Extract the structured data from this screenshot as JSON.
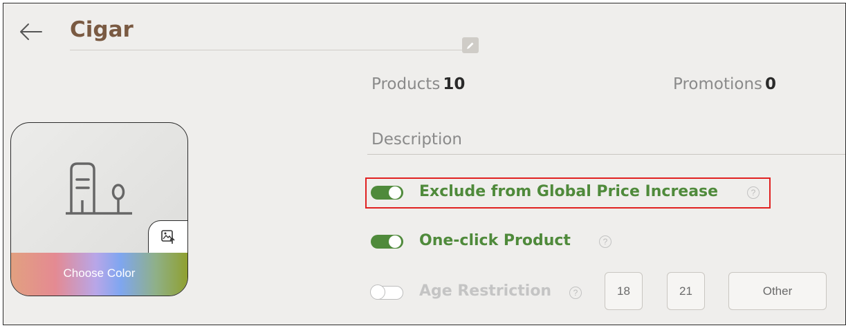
{
  "header": {
    "title": "Cigar"
  },
  "stats": {
    "products_label": "Products",
    "products_value": "10",
    "promotions_label": "Promotions",
    "promotions_value": "0"
  },
  "description": {
    "placeholder": "Description"
  },
  "card": {
    "choose_color_label": "Choose Color"
  },
  "options": {
    "exclude_global": {
      "label": "Exclude from Global Price Increase",
      "enabled": true,
      "help": "?"
    },
    "one_click": {
      "label": "One-click Product",
      "enabled": true,
      "help": "?"
    },
    "age_restriction": {
      "label": "Age Restriction",
      "enabled": false,
      "help": "?",
      "choices": [
        "18",
        "21",
        "Other"
      ]
    }
  },
  "colors": {
    "brand_title": "#7a5a42",
    "toggle_on": "#4f8a3b",
    "highlight": "#e02020"
  }
}
